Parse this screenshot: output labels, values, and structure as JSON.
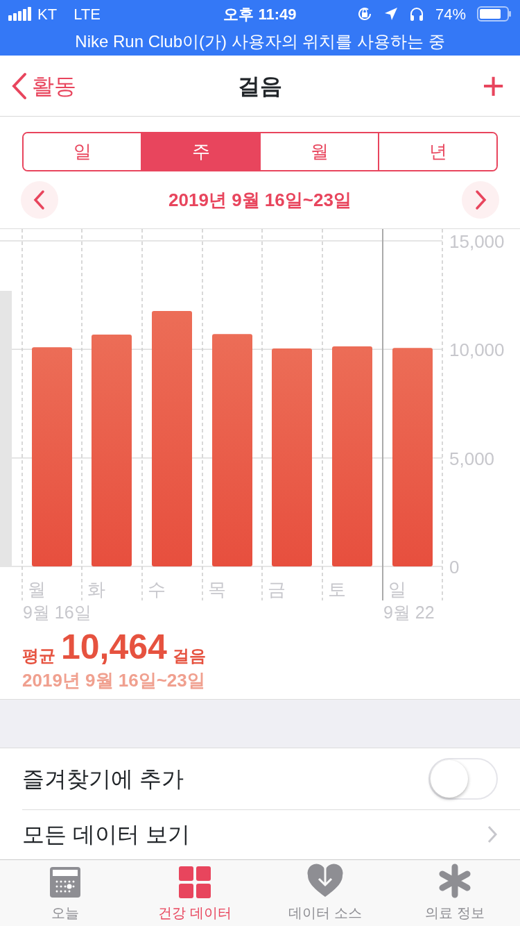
{
  "status_bar": {
    "carrier": "KT",
    "network": "LTE",
    "time": "오후 11:49",
    "battery": "74%"
  },
  "location_banner": "Nike Run Club이(가) 사용자의 위치를 사용하는 중",
  "nav": {
    "back": "활동",
    "title": "걸음",
    "add": "+"
  },
  "segments": [
    {
      "label": "일",
      "selected": false
    },
    {
      "label": "주",
      "selected": true
    },
    {
      "label": "월",
      "selected": false
    },
    {
      "label": "년",
      "selected": false
    }
  ],
  "date_range": "2019년 9월 16일~23일",
  "chart": {
    "chart_data": {
      "type": "bar",
      "categories": [
        "월",
        "화",
        "수",
        "목",
        "금",
        "토",
        "일"
      ],
      "values": [
        10100,
        10680,
        11770,
        10710,
        10040,
        10140,
        10070
      ],
      "ylim": [
        0,
        15000
      ],
      "yticks": [
        {
          "value": 0,
          "label": "0"
        },
        {
          "value": 5000,
          "label": "5,000"
        },
        {
          "value": 10000,
          "label": "10,000"
        },
        {
          "value": 15000,
          "label": "15,000"
        }
      ]
    },
    "start_date": "9월 16일",
    "end_date": "9월 22"
  },
  "average": {
    "prefix": "평균",
    "value": "10,464",
    "unit": "걸음",
    "range": "2019년 9월 16일~23일"
  },
  "list": [
    {
      "kind": "toggle",
      "label": "즐겨찾기에 추가",
      "on": false
    },
    {
      "kind": "link",
      "label": "모든 데이터 보기"
    }
  ],
  "tab_bar": [
    {
      "label": "오늘",
      "selected": false
    },
    {
      "label": "건강 데이터",
      "selected": true
    },
    {
      "label": "데이터 소스",
      "selected": false
    },
    {
      "label": "의료 정보",
      "selected": false
    }
  ]
}
